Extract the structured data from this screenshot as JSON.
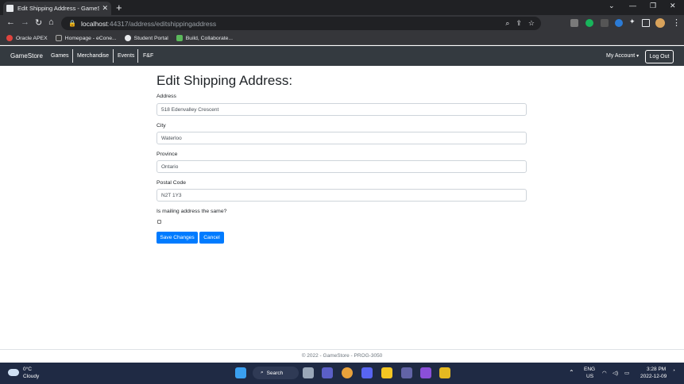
{
  "browser": {
    "tab_title": "Edit Shipping Address - GameSt",
    "url_host": "localhost",
    "url_path": ":44317/address/editshippingaddress",
    "bookmarks": [
      {
        "label": "Oracle APEX",
        "color": "#e0443e"
      },
      {
        "label": "Homepage - eCone...",
        "color": "#3a3a3a"
      },
      {
        "label": "Student Portal",
        "color": "#e8eaed"
      },
      {
        "label": "Build, Collaborate...",
        "color": "#5bb85b"
      }
    ]
  },
  "navbar": {
    "brand": "GameStore",
    "links": [
      "Games",
      "Merchandise",
      "Events",
      "F&F"
    ],
    "account_label": "My Account",
    "logout_label": "Log Out",
    "background": "#343a40"
  },
  "form": {
    "title": "Edit Shipping Address:",
    "fields": [
      {
        "label": "Address",
        "value": "518 Edenvalley Crescent"
      },
      {
        "label": "City",
        "value": "Waterloo"
      },
      {
        "label": "Province",
        "value": "Ontario"
      },
      {
        "label": "Postal Code",
        "value": "N2T 1Y3"
      }
    ],
    "checkbox_label": "Is mailing address the same?",
    "checkbox_checked": false,
    "save_label": "Save Changes",
    "cancel_label": "Cancel",
    "accent": "#007bff"
  },
  "footer": {
    "text": "© 2022 - GameStore - PROG-3050"
  },
  "taskbar": {
    "temperature": "0°C",
    "condition": "Cloudy",
    "search_label": "Search",
    "language": "ENG",
    "region": "US",
    "time": "3:28 PM",
    "date": "2022-12-09"
  }
}
